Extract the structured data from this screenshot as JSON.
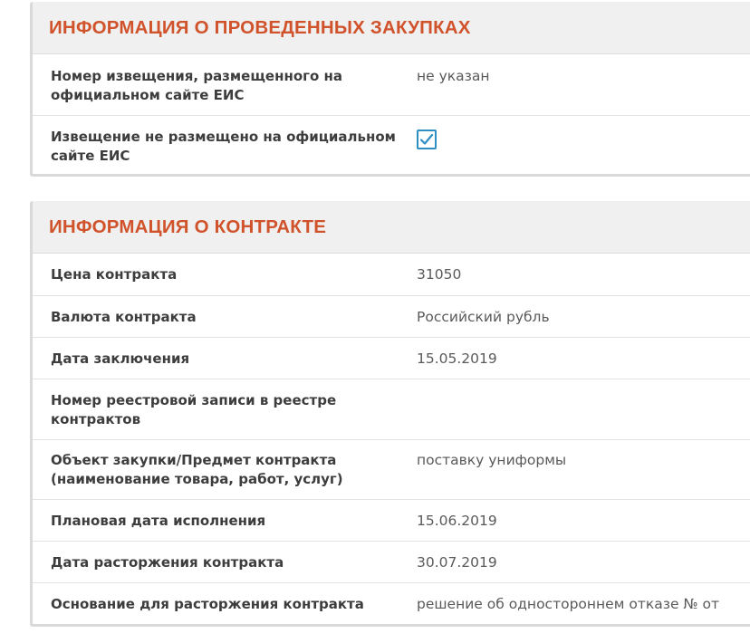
{
  "procurement": {
    "title": "ИНФОРМАЦИЯ О ПРОВЕДЕННЫХ ЗАКУПКАХ",
    "rows": [
      {
        "label": "Номер извещения, размещенного на официальном сайте ЕИС",
        "value": "не указан"
      },
      {
        "label": "Извещение не размещено на официальном сайте ЕИС",
        "checked": true
      }
    ]
  },
  "contract": {
    "title": "ИНФОРМАЦИЯ О КОНТРАКТЕ",
    "rows": [
      {
        "label": "Цена контракта",
        "value": "31050"
      },
      {
        "label": "Валюта контракта",
        "value": "Российский рубль"
      },
      {
        "label": "Дата заключения",
        "value": "15.05.2019"
      },
      {
        "label": "Номер реестровой записи в реестре контрактов",
        "value": ""
      },
      {
        "label": "Объект закупки/Предмет контракта (наименование товара, работ, услуг)",
        "value": "поставку униформы"
      },
      {
        "label": "Плановая дата исполнения",
        "value": "15.06.2019"
      },
      {
        "label": "Дата расторжения контракта",
        "value": "30.07.2019"
      },
      {
        "label": "Основание для расторжения контракта",
        "value": "решение об одностороннем отказе № от"
      }
    ]
  },
  "colors": {
    "title": "#d0532b",
    "checkbox": "#2d8fc4"
  },
  "icons": {
    "checkbox": "checkmark-icon"
  }
}
